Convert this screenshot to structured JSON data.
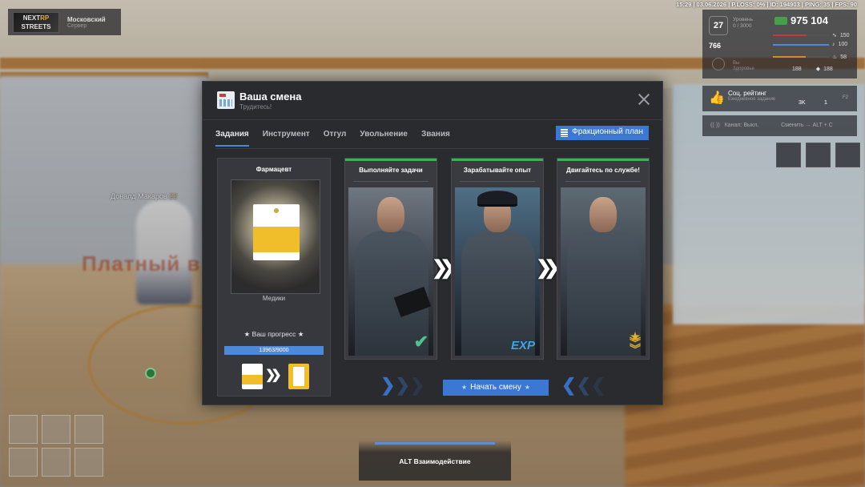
{
  "status_bar": "15:29 | 03.06.2026 | P.LOSS: 0% | ID: 194903 | PING: 35 | FPS: 90",
  "server": {
    "logo_line1": "NEXT",
    "logo_line2": "RP",
    "logo_line3": "STREETS",
    "city": "Московский",
    "sub": "Сервер"
  },
  "hud": {
    "level": "27",
    "level_label": "Уровень",
    "level_sub": "0 / 3000",
    "money": "975 104",
    "stat_value": "766",
    "bars": [
      {
        "icon": "heartbeat-icon",
        "value": "150",
        "color": "#c9393b"
      },
      {
        "icon": "mic-icon",
        "value": "100",
        "color": "#4e88d8"
      },
      {
        "icon": "food-icon",
        "value": "58",
        "color": "#d58a2b"
      },
      {
        "icon": "shield-icon",
        "value": "188",
        "color": "#8fbf5a"
      }
    ],
    "small_value": "188",
    "lower_label": "Вы",
    "lower_sub": "Здоровье"
  },
  "social": {
    "title": "Соц. рейтинг",
    "sub": "Ежедневное задание",
    "val1": "3K",
    "val2": "1",
    "key": "F2"
  },
  "channel": {
    "label": "Канал: Выкл.",
    "hint": "Сменить →",
    "keys": "ALT + C"
  },
  "world": {
    "npc_name": "Доналд Макаров",
    "npc_tag": "22",
    "wall_text": "Платный в"
  },
  "modal": {
    "title": "Ваша смена",
    "subtitle": "Трудитесь!",
    "tabs": [
      "Задания",
      "Инструмент",
      "Отгул",
      "Увольнение",
      "Звания"
    ],
    "active_tab": 0,
    "faction_plan": "Фракционный план",
    "progress_card": {
      "rank_title": "Фармацевт",
      "department": "Медики",
      "progress_label": "★ Ваш прогресс ★",
      "progress_text": "13963/9000"
    },
    "steps": [
      {
        "caption": "Выполняйте задачи",
        "badge": "✓",
        "badge_name": "checkmark-icon"
      },
      {
        "caption": "Зарабатывайте опыт",
        "badge": "EXP",
        "badge_name": "exp-icon"
      },
      {
        "caption": "Двигайтесь по службе!",
        "badge": "rank",
        "badge_name": "rank-chevron-icon"
      }
    ],
    "start_button": "Начать смену"
  },
  "alt_hint": "ALT Взаимодействие"
}
